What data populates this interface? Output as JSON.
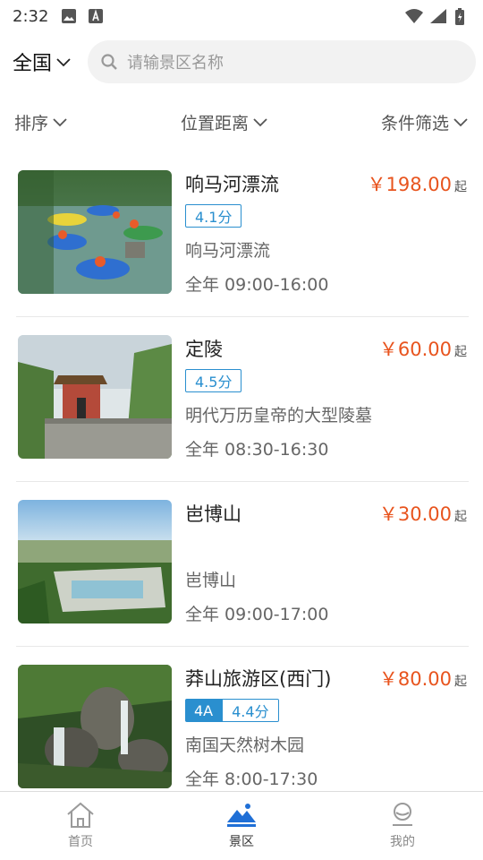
{
  "status_bar": {
    "time": "2:32"
  },
  "header": {
    "region": "全国",
    "search_placeholder": "请输景区名称"
  },
  "filters": [
    {
      "label": "排序"
    },
    {
      "label": "位置距离"
    },
    {
      "label": "条件筛选"
    }
  ],
  "items": [
    {
      "title": "响马河漂流",
      "price": "￥198.00",
      "price_suffix": "起",
      "rating": "4.1分",
      "level": "",
      "description": "响马河漂流",
      "hours": "全年 09:00-16:00",
      "image": "rafting-photo"
    },
    {
      "title": "定陵",
      "price": "￥60.00",
      "price_suffix": "起",
      "rating": "4.5分",
      "level": "",
      "description": "明代万历皇帝的大型陵墓",
      "hours": "全年 08:30-16:30",
      "image": "tomb-tower-photo"
    },
    {
      "title": "岜博山",
      "price": "￥30.00",
      "price_suffix": "起",
      "rating": "",
      "level": "",
      "description": "岜博山",
      "hours": "全年 09:00-17:00",
      "image": "mountain-view-photo"
    },
    {
      "title": "莽山旅游区(西门)",
      "price": "￥80.00",
      "price_suffix": "起",
      "rating": "4.4分",
      "level": "4A",
      "description": "南国天然树木园",
      "hours": "全年 8:00-17:30",
      "image": "waterfall-photo"
    }
  ],
  "bottom_nav": [
    {
      "label": "首页",
      "icon": "home-icon",
      "active": false
    },
    {
      "label": "景区",
      "icon": "scenic-icon",
      "active": true
    },
    {
      "label": "我的",
      "icon": "profile-icon",
      "active": false
    }
  ],
  "colors": {
    "price": "#e8541e",
    "accent": "#2a8fcf",
    "active_nav": "#1f6fd6"
  }
}
